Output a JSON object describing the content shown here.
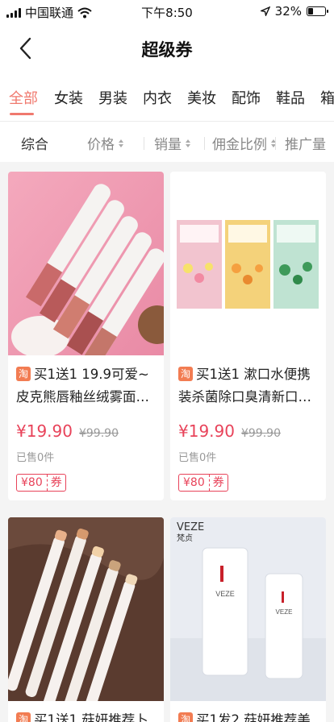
{
  "status_bar": {
    "carrier": "中国联通",
    "time": "下午8:50",
    "battery": "32%",
    "battery_level": 0.32
  },
  "nav": {
    "title": "超级券"
  },
  "category_tabs": [
    {
      "label": "全部",
      "active": true
    },
    {
      "label": "女装",
      "active": false
    },
    {
      "label": "男装",
      "active": false
    },
    {
      "label": "内衣",
      "active": false
    },
    {
      "label": "美妆",
      "active": false
    },
    {
      "label": "配饰",
      "active": false
    },
    {
      "label": "鞋品",
      "active": false
    },
    {
      "label": "箱",
      "active": false
    }
  ],
  "sort_bar": {
    "items": [
      {
        "label": "综合",
        "has_arrows": false
      },
      {
        "label": "价格",
        "has_arrows": true
      },
      {
        "label": "销量",
        "has_arrows": true
      },
      {
        "label": "佣金比例",
        "has_arrows": true
      },
      {
        "label": "推广量",
        "has_arrows": false
      }
    ]
  },
  "products": [
    {
      "badge": "淘",
      "title": "买1送1 19.9可爱~皮克熊唇釉丝绒雾面…",
      "price": "¥19.90",
      "orig_price": "¥99.90",
      "sold": "已售0件",
      "coupon_amount": "¥80",
      "coupon_label": "券"
    },
    {
      "badge": "淘",
      "title": "买1送1 漱口水便携装杀菌除口臭清新口…",
      "price": "¥19.90",
      "orig_price": "¥99.90",
      "sold": "已售0件",
      "coupon_amount": "¥80",
      "coupon_label": "券"
    },
    {
      "badge": "淘",
      "title": "买1送1 菇妍推荐卜",
      "price": "",
      "orig_price": "",
      "sold": "",
      "coupon_amount": "",
      "coupon_label": ""
    },
    {
      "badge": "淘",
      "title": "买1发2 菇妍推荐美",
      "brand_text": "VEZE",
      "brand_sub": "梵贞",
      "price": "",
      "orig_price": "",
      "sold": "",
      "coupon_amount": "",
      "coupon_label": ""
    }
  ],
  "colors": {
    "accent": "#f0796e",
    "price": "#e8435a",
    "taobao_badge": "#f27c52"
  }
}
